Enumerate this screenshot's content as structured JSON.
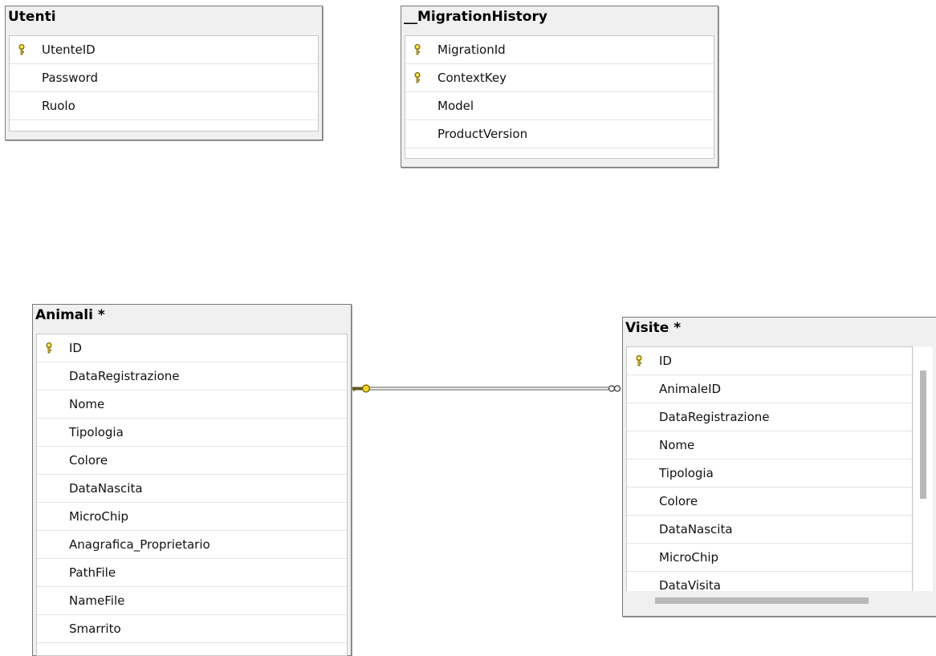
{
  "tables": {
    "utenti": {
      "title": "Utenti",
      "columns": [
        {
          "name": "UtenteID",
          "key": true
        },
        {
          "name": "Password",
          "key": false
        },
        {
          "name": "Ruolo",
          "key": false
        }
      ]
    },
    "migration": {
      "title": "__MigrationHistory",
      "columns": [
        {
          "name": "MigrationId",
          "key": true
        },
        {
          "name": "ContextKey",
          "key": true
        },
        {
          "name": "Model",
          "key": false
        },
        {
          "name": "ProductVersion",
          "key": false
        }
      ]
    },
    "animali": {
      "title": "Animali *",
      "columns": [
        {
          "name": "ID",
          "key": true
        },
        {
          "name": "DataRegistrazione",
          "key": false
        },
        {
          "name": "Nome",
          "key": false
        },
        {
          "name": "Tipologia",
          "key": false
        },
        {
          "name": "Colore",
          "key": false
        },
        {
          "name": "DataNascita",
          "key": false
        },
        {
          "name": "MicroChip",
          "key": false
        },
        {
          "name": "Anagrafica_Proprietario",
          "key": false
        },
        {
          "name": "PathFile",
          "key": false
        },
        {
          "name": "NameFile",
          "key": false
        },
        {
          "name": "Smarrito",
          "key": false
        }
      ]
    },
    "visite": {
      "title": "Visite *",
      "columns": [
        {
          "name": "ID",
          "key": true
        },
        {
          "name": "AnimaleID",
          "key": false
        },
        {
          "name": "DataRegistrazione",
          "key": false
        },
        {
          "name": "Nome",
          "key": false
        },
        {
          "name": "Tipologia",
          "key": false
        },
        {
          "name": "Colore",
          "key": false
        },
        {
          "name": "DataNascita",
          "key": false
        },
        {
          "name": "MicroChip",
          "key": false
        },
        {
          "name": "DataVisita",
          "key": false
        }
      ]
    }
  },
  "relationship": {
    "from": "Animali",
    "to": "Visite",
    "from_end": "key-icon",
    "to_end": "infinity-icon"
  },
  "colors": {
    "key_icon": "#f2d21b",
    "key_outline": "#6b5a00",
    "relation_line": "#555555"
  }
}
